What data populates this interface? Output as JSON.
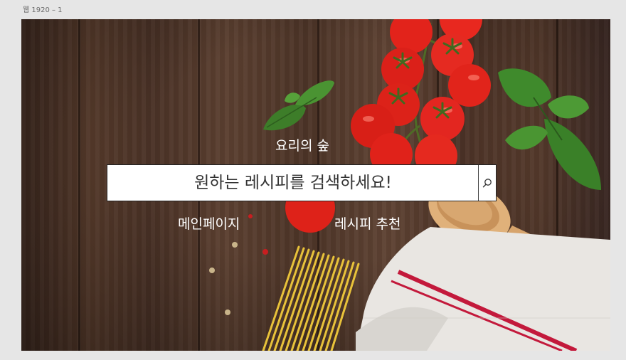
{
  "frame": {
    "label": "웹 1920 – 1"
  },
  "hero": {
    "title": "요리의 숲",
    "search": {
      "placeholder": "원하는 레시피를 검색하세요!",
      "icon": "search-icon"
    }
  },
  "nav": {
    "items": [
      {
        "label": "메인페이지"
      },
      {
        "label": "레시피 추천"
      }
    ]
  },
  "colors": {
    "wood": "#4f3628",
    "tomato": "#e8211a",
    "basil": "#3f8a2c",
    "pasta": "#e8c23a",
    "towel_stripe": "#c3193b"
  }
}
